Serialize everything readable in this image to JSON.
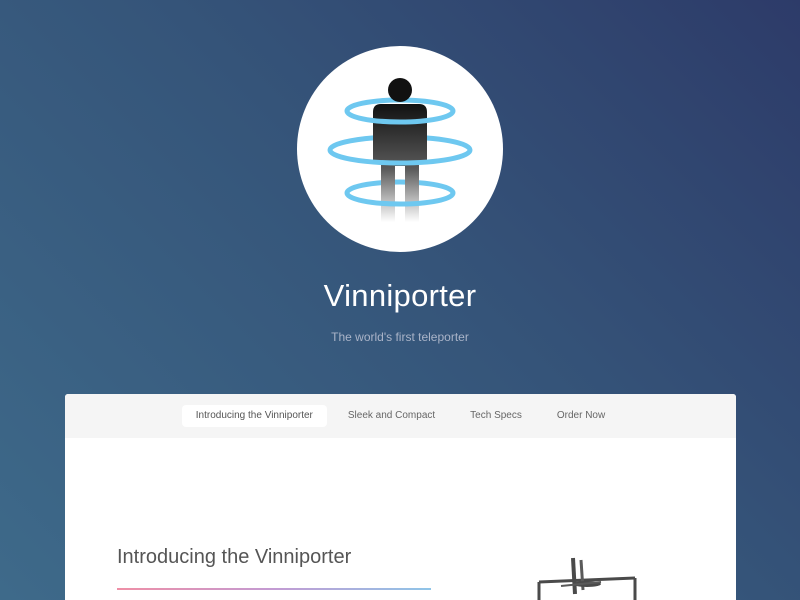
{
  "site": {
    "title": "Vinniporter",
    "tagline": "The world's first teleporter"
  },
  "nav": {
    "items": [
      {
        "label": "Introducing the Vinniporter",
        "active": true
      },
      {
        "label": "Sleek and Compact",
        "active": false
      },
      {
        "label": "Tech Specs",
        "active": false
      },
      {
        "label": "Order Now",
        "active": false
      }
    ]
  },
  "content": {
    "section_heading": "Introducing the Vinniporter"
  },
  "icons": {
    "logo": "teleporter-person-icon",
    "device": "teleporter-device-icon"
  },
  "colors": {
    "background_start": "#2d3b69",
    "background_end": "#3e6a8a",
    "ring": "#6ec8f0",
    "underline_start": "#ef8fa6",
    "underline_end": "#8fc5e8"
  }
}
